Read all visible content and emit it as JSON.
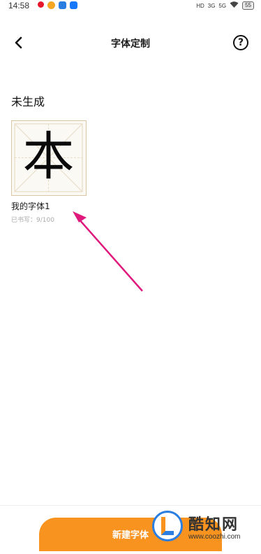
{
  "status_bar": {
    "time": "14:58",
    "signal_labels": [
      "HD",
      "3G",
      "5G"
    ],
    "battery": "55"
  },
  "header": {
    "title": "字体定制",
    "back_icon": "chevron-left-icon",
    "help_icon": "question-circle-icon",
    "help_symbol": "?"
  },
  "section": {
    "heading": "未生成"
  },
  "font_card": {
    "preview_char": "本",
    "name": "我的字体1",
    "progress": "已书写：9/100"
  },
  "footer": {
    "new_font_label": "新建字体"
  },
  "watermark": {
    "name": "酷知网",
    "url": "www.coozhi.com"
  },
  "colors": {
    "accent": "#f7931e",
    "annotation_arrow": "#e0197d",
    "grid_line": "#d8c7a5"
  }
}
